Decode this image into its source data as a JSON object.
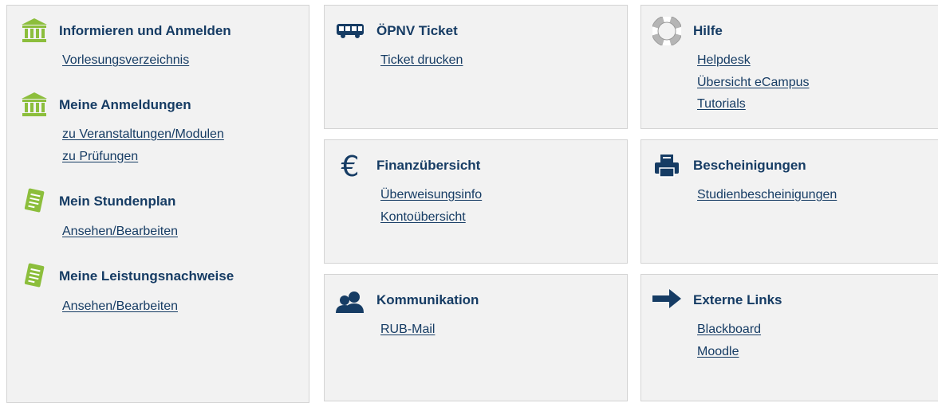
{
  "left": {
    "sections": [
      {
        "title": "Informieren und Anmelden",
        "icon": "institution-icon",
        "links": [
          "Vorlesungsverzeichnis"
        ]
      },
      {
        "title": "Meine Anmeldungen",
        "icon": "institution-icon",
        "links": [
          "zu Veranstaltungen/Modulen",
          "zu Prüfungen"
        ]
      },
      {
        "title": "Mein Stundenplan",
        "icon": "notepad-icon",
        "links": [
          "Ansehen/Bearbeiten"
        ]
      },
      {
        "title": "Meine Leistungsnachweise",
        "icon": "notepad-icon",
        "links": [
          "Ansehen/Bearbeiten"
        ]
      }
    ]
  },
  "tiles": {
    "oepnv": {
      "title": "ÖPNV Ticket",
      "icon": "bus-icon",
      "links": [
        "Ticket drucken"
      ]
    },
    "hilfe": {
      "title": "Hilfe",
      "icon": "lifebuoy-icon",
      "links": [
        "Helpdesk",
        "Übersicht eCampus",
        "Tutorials"
      ]
    },
    "finanz": {
      "title": "Finanzübersicht",
      "icon": "euro-icon",
      "icon_glyph": "€",
      "links": [
        "Überweisungsinfo",
        "Kontoübersicht"
      ]
    },
    "besch": {
      "title": "Bescheinigungen",
      "icon": "printer-icon",
      "links": [
        "Studienbescheinigungen"
      ]
    },
    "komm": {
      "title": "Kommunikation",
      "icon": "users-icon",
      "links": [
        "RUB-Mail"
      ]
    },
    "ext": {
      "title": "Externe Links",
      "icon": "arrow-right-icon",
      "links": [
        "Blackboard",
        "Moodle"
      ]
    }
  },
  "colors": {
    "text": "#163c64",
    "icon_green": "#8cbe3c",
    "panel_bg": "#f2f2f2",
    "panel_border": "#d4d4d4"
  }
}
